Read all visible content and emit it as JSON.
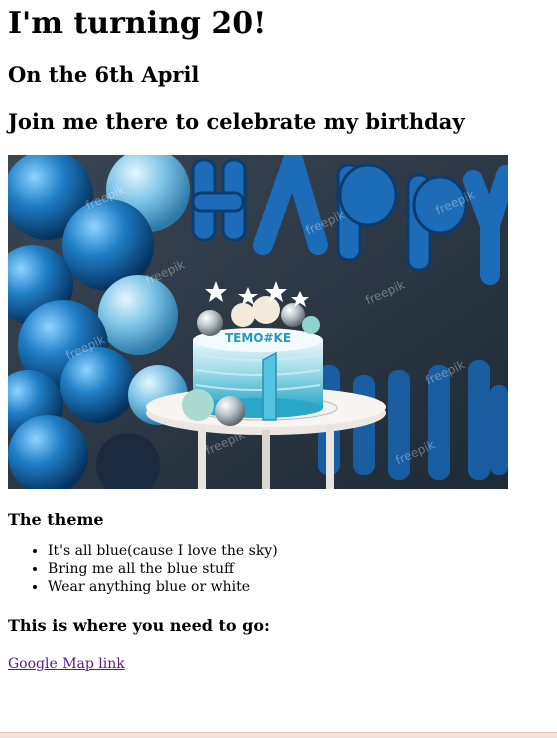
{
  "header": {
    "title": "I'm turning 20!",
    "date": "On the 6th April",
    "invite": "Join me there to celebrate my birthday"
  },
  "photo": {
    "icon": "birthday-cake-photo",
    "cake_topper_text": "TEMO#KE",
    "watermark": "freepik",
    "colors": {
      "balloon_blue": "#0b5fa8",
      "background": "#2a3a4a"
    }
  },
  "theme": {
    "heading": "The theme",
    "items": [
      "It's all blue(cause I love the sky)",
      "Bring me all the blue stuff",
      "Wear anything blue or white"
    ]
  },
  "location": {
    "heading": "This is where you need to go:",
    "link_text": "Google Map link"
  },
  "colors": {
    "link": "#551a8b"
  }
}
